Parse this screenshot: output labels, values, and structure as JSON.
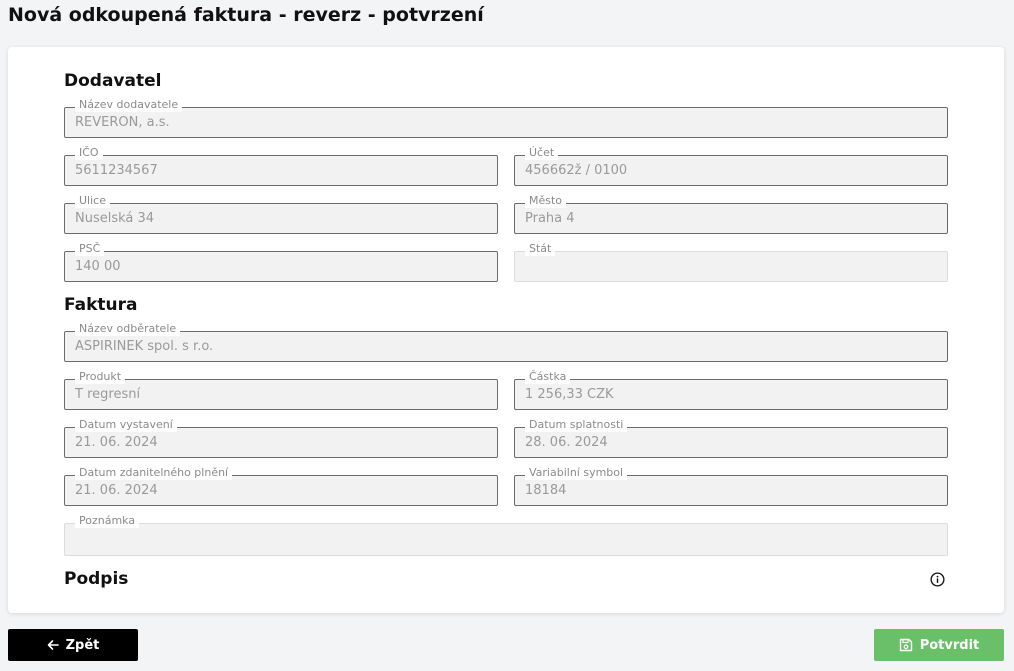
{
  "page": {
    "title": "Nová odkoupená faktura - reverz - potvrzení"
  },
  "supplier": {
    "heading": "Dodavatel",
    "fields": {
      "name": {
        "label": "Název dodavatele",
        "value": "REVERON, a.s."
      },
      "ico": {
        "label": "IČO",
        "value": "5611234567"
      },
      "account": {
        "label": "Účet",
        "value": "456662ž / 0100"
      },
      "street": {
        "label": "Ulice",
        "value": "Nuselská 34"
      },
      "city": {
        "label": "Město",
        "value": "Praha 4"
      },
      "zip": {
        "label": "PSČ",
        "value": "140 00"
      },
      "country": {
        "label": "Stát",
        "value": ""
      }
    }
  },
  "invoice": {
    "heading": "Faktura",
    "fields": {
      "customer": {
        "label": "Název odběratele",
        "value": "ASPIRINEK spol. s r.o."
      },
      "product": {
        "label": "Produkt",
        "value": "T regresní"
      },
      "amount": {
        "label": "Částka",
        "value": "1 256,33 CZK"
      },
      "issue_date": {
        "label": "Datum vystavení",
        "value": "21. 06. 2024"
      },
      "due_date": {
        "label": "Datum splatnosti",
        "value": "28. 06. 2024"
      },
      "taxable_date": {
        "label": "Datum zdanitelného plnění",
        "value": "21. 06. 2024"
      },
      "variable_symbol": {
        "label": "Variabilní symbol",
        "value": "18184"
      },
      "note": {
        "label": "Poznámka",
        "value": ""
      }
    }
  },
  "signature": {
    "heading": "Podpis",
    "icon": "info-icon"
  },
  "actions": {
    "back_label": "Zpět",
    "back_icon": "arrow-left-icon",
    "confirm_label": "Potvrdit",
    "confirm_icon": "save-icon"
  },
  "colors": {
    "confirm": "#6abf69",
    "back": "#000000",
    "background": "#f3f4f6"
  }
}
